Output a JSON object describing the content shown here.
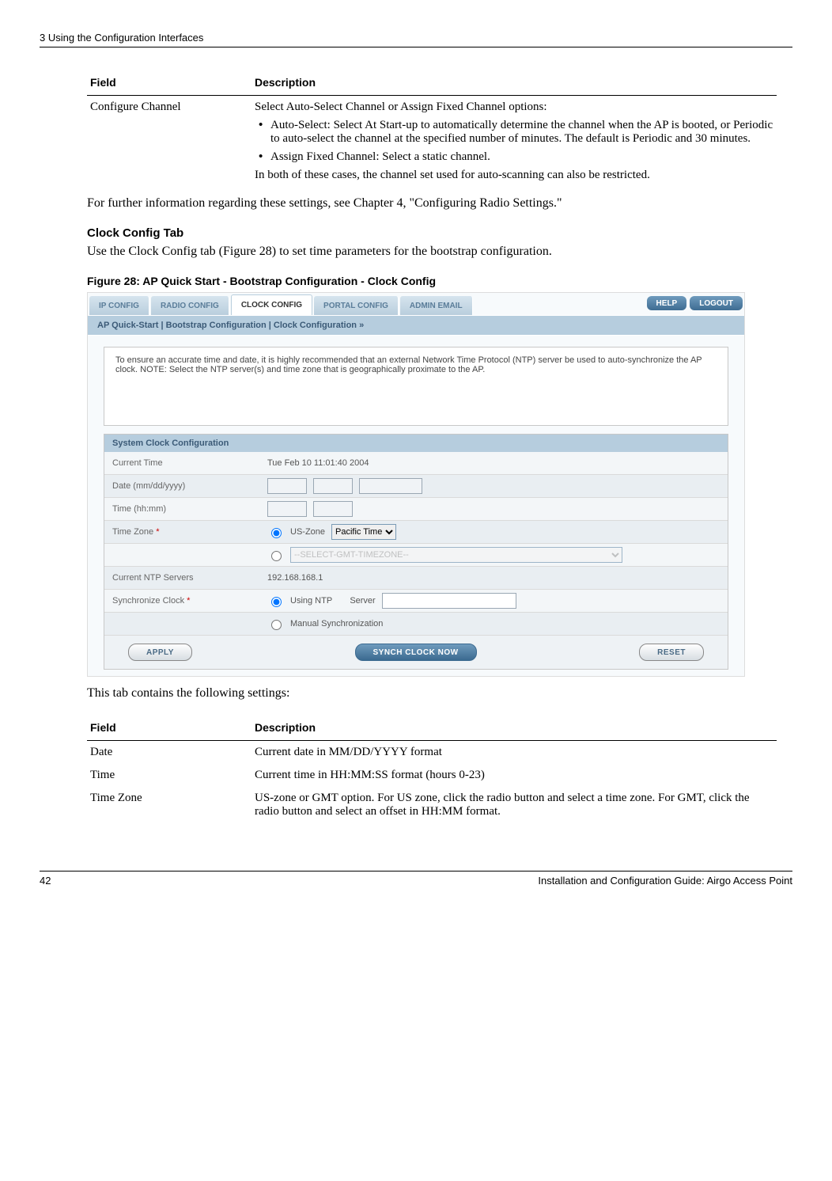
{
  "header": {
    "chapter": "3  Using the Configuration Interfaces"
  },
  "field_table_1": {
    "col_field": "Field",
    "col_desc": "Description",
    "rows": [
      {
        "field": "Configure Channel",
        "intro": "Select Auto-Select Channel or Assign Fixed Channel options:",
        "bullets": [
          "Auto-Select: Select At Start-up to automatically determine the channel when the AP is booted, or Periodic to auto-select the channel at the specified number of minutes. The default is Periodic and 30 minutes.",
          "Assign Fixed Channel: Select a static channel."
        ],
        "outro": "In both of these cases, the channel set used for auto-scanning can also be restricted."
      }
    ]
  },
  "para1": "For further information regarding these settings, see Chapter 4,  \"Configuring Radio Settings.\"",
  "heading1": "Clock Config Tab",
  "para2": "Use the Clock Config tab (Figure 28) to set time parameters for the bootstrap configuration.",
  "fig_caption": "Figure 28:      AP Quick Start - Bootstrap Configuration - Clock Config",
  "screenshot": {
    "tabs": [
      "IP CONFIG",
      "RADIO CONFIG",
      "CLOCK CONFIG",
      "PORTAL CONFIG",
      "ADMIN EMAIL"
    ],
    "active_tab": 2,
    "help": "HELP",
    "logout": "LOGOUT",
    "breadcrumb": "AP Quick-Start | Bootstrap Configuration | Clock Configuration  »",
    "info_text": "To ensure an accurate time and date, it is highly recommended that an external Network Time Protocol (NTP) server be used to auto-synchronize the AP clock. NOTE: Select the NTP server(s) and time zone that is geographically proximate to the AP.",
    "settings_title": "System Clock Configuration",
    "rows": {
      "current_time": {
        "label": "Current Time",
        "value": "Tue Feb 10 11:01:40 2004"
      },
      "date": {
        "label": "Date (mm/dd/yyyy)"
      },
      "time": {
        "label": "Time (hh:mm)"
      },
      "tz": {
        "label": "Time Zone",
        "required": "*",
        "us_zone": "US-Zone",
        "zone_value": "Pacific Time"
      },
      "gmt_placeholder": "--SELECT-GMT-TIMEZONE--",
      "ntp_servers": {
        "label": "Current NTP Servers",
        "value": "192.168.168.1"
      },
      "sync": {
        "label": "Synchronize Clock",
        "required": "*",
        "using_ntp": "Using NTP",
        "server_label": "Server",
        "manual": "Manual Synchronization"
      }
    },
    "buttons": {
      "apply": "APPLY",
      "sync_now": "SYNCH CLOCK NOW",
      "reset": "RESET"
    }
  },
  "para3": "This tab contains the following settings:",
  "field_table_2": {
    "col_field": "Field",
    "col_desc": "Description",
    "rows": [
      {
        "field": "Date",
        "desc": "Current date in MM/DD/YYYY format"
      },
      {
        "field": "Time",
        "desc": "Current time in HH:MM:SS format (hours 0-23)"
      },
      {
        "field": "Time Zone",
        "desc": "US-zone or GMT option. For US zone, click the radio button and select a time zone. For GMT, click the radio button and select an offset in HH:MM format."
      }
    ]
  },
  "footer": {
    "page": "42",
    "title": "Installation and Configuration Guide: Airgo Access Point"
  }
}
